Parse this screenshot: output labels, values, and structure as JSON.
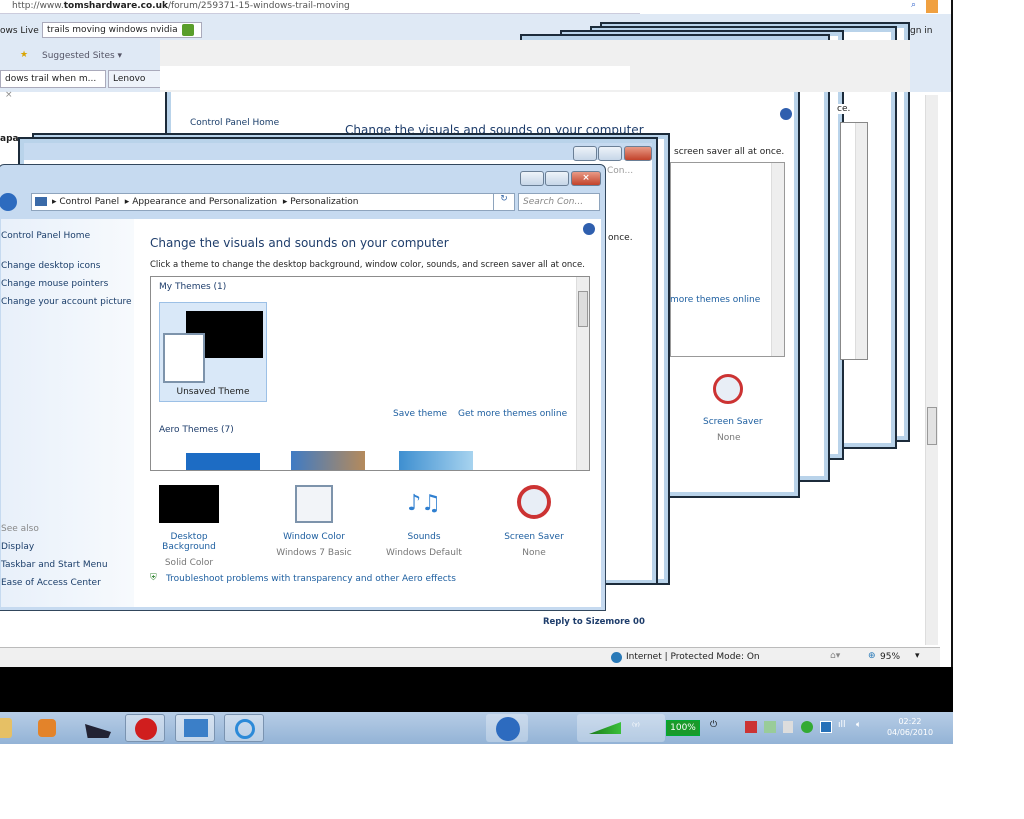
{
  "browser": {
    "url_prefix": "http://www.",
    "url_domain": "tomshardware.co.uk",
    "url_path": "/forum/259371-15-windows-trail-moving",
    "windows_live_label": "ows Live",
    "search_value": "trails moving windows nvidia",
    "suggested_sites": "Suggested Sites ▾",
    "tab_active": "dows trail when m...",
    "tab_other": "Lenovo",
    "sign_in": "gn in",
    "reply_link": "Reply to Sizemore 00",
    "status_zone": "Internet | Protected Mode: On",
    "zoom": "95%",
    "sidebar_partial": "apa"
  },
  "window": {
    "breadcrumb": [
      "Control Panel",
      "Appearance and Personalization",
      "Personalization"
    ],
    "search_placeholder": "Search Con...",
    "left_links": [
      "Control Panel Home",
      "Change desktop icons",
      "Change mouse pointers",
      "Change your account picture"
    ],
    "see_also_label": "See also",
    "see_also": [
      "Display",
      "Taskbar and Start Menu",
      "Ease of Access Center"
    ],
    "heading": "Change the visuals and sounds on your computer",
    "subheading": "Click a theme to change the desktop background, window color, sounds, and screen saver all at once.",
    "my_themes": "My Themes (1)",
    "unsaved_theme": "Unsaved Theme",
    "save_theme": "Save theme",
    "get_more": "Get more themes online",
    "aero_themes": "Aero Themes (7)",
    "settings": [
      {
        "label": "Desktop Background",
        "value": "Solid Color",
        "icon": "black-square"
      },
      {
        "label": "Window Color",
        "value": "Windows 7 Basic",
        "icon": "window-color"
      },
      {
        "label": "Sounds",
        "value": "Windows Default",
        "icon": "music-notes"
      },
      {
        "label": "Screen Saver",
        "value": "None",
        "icon": "no-screensaver"
      }
    ],
    "troubleshoot": "Troubleshoot problems with transparency and other Aero effects"
  },
  "trail": {
    "partial_subheading": "screen saver all at once.",
    "partial_once": "once.",
    "partial_more": "more themes online",
    "partial_ce": "ce.",
    "partial_heading": "Change the visuals and sounds on your computer",
    "partial_home": "Control Panel Home",
    "partial_search": "Con...",
    "screen_saver": "Screen Saver",
    "screen_saver_value": "None"
  },
  "taskbar": {
    "battery": "100%",
    "time": "02:22",
    "date": "04/06/2010"
  }
}
